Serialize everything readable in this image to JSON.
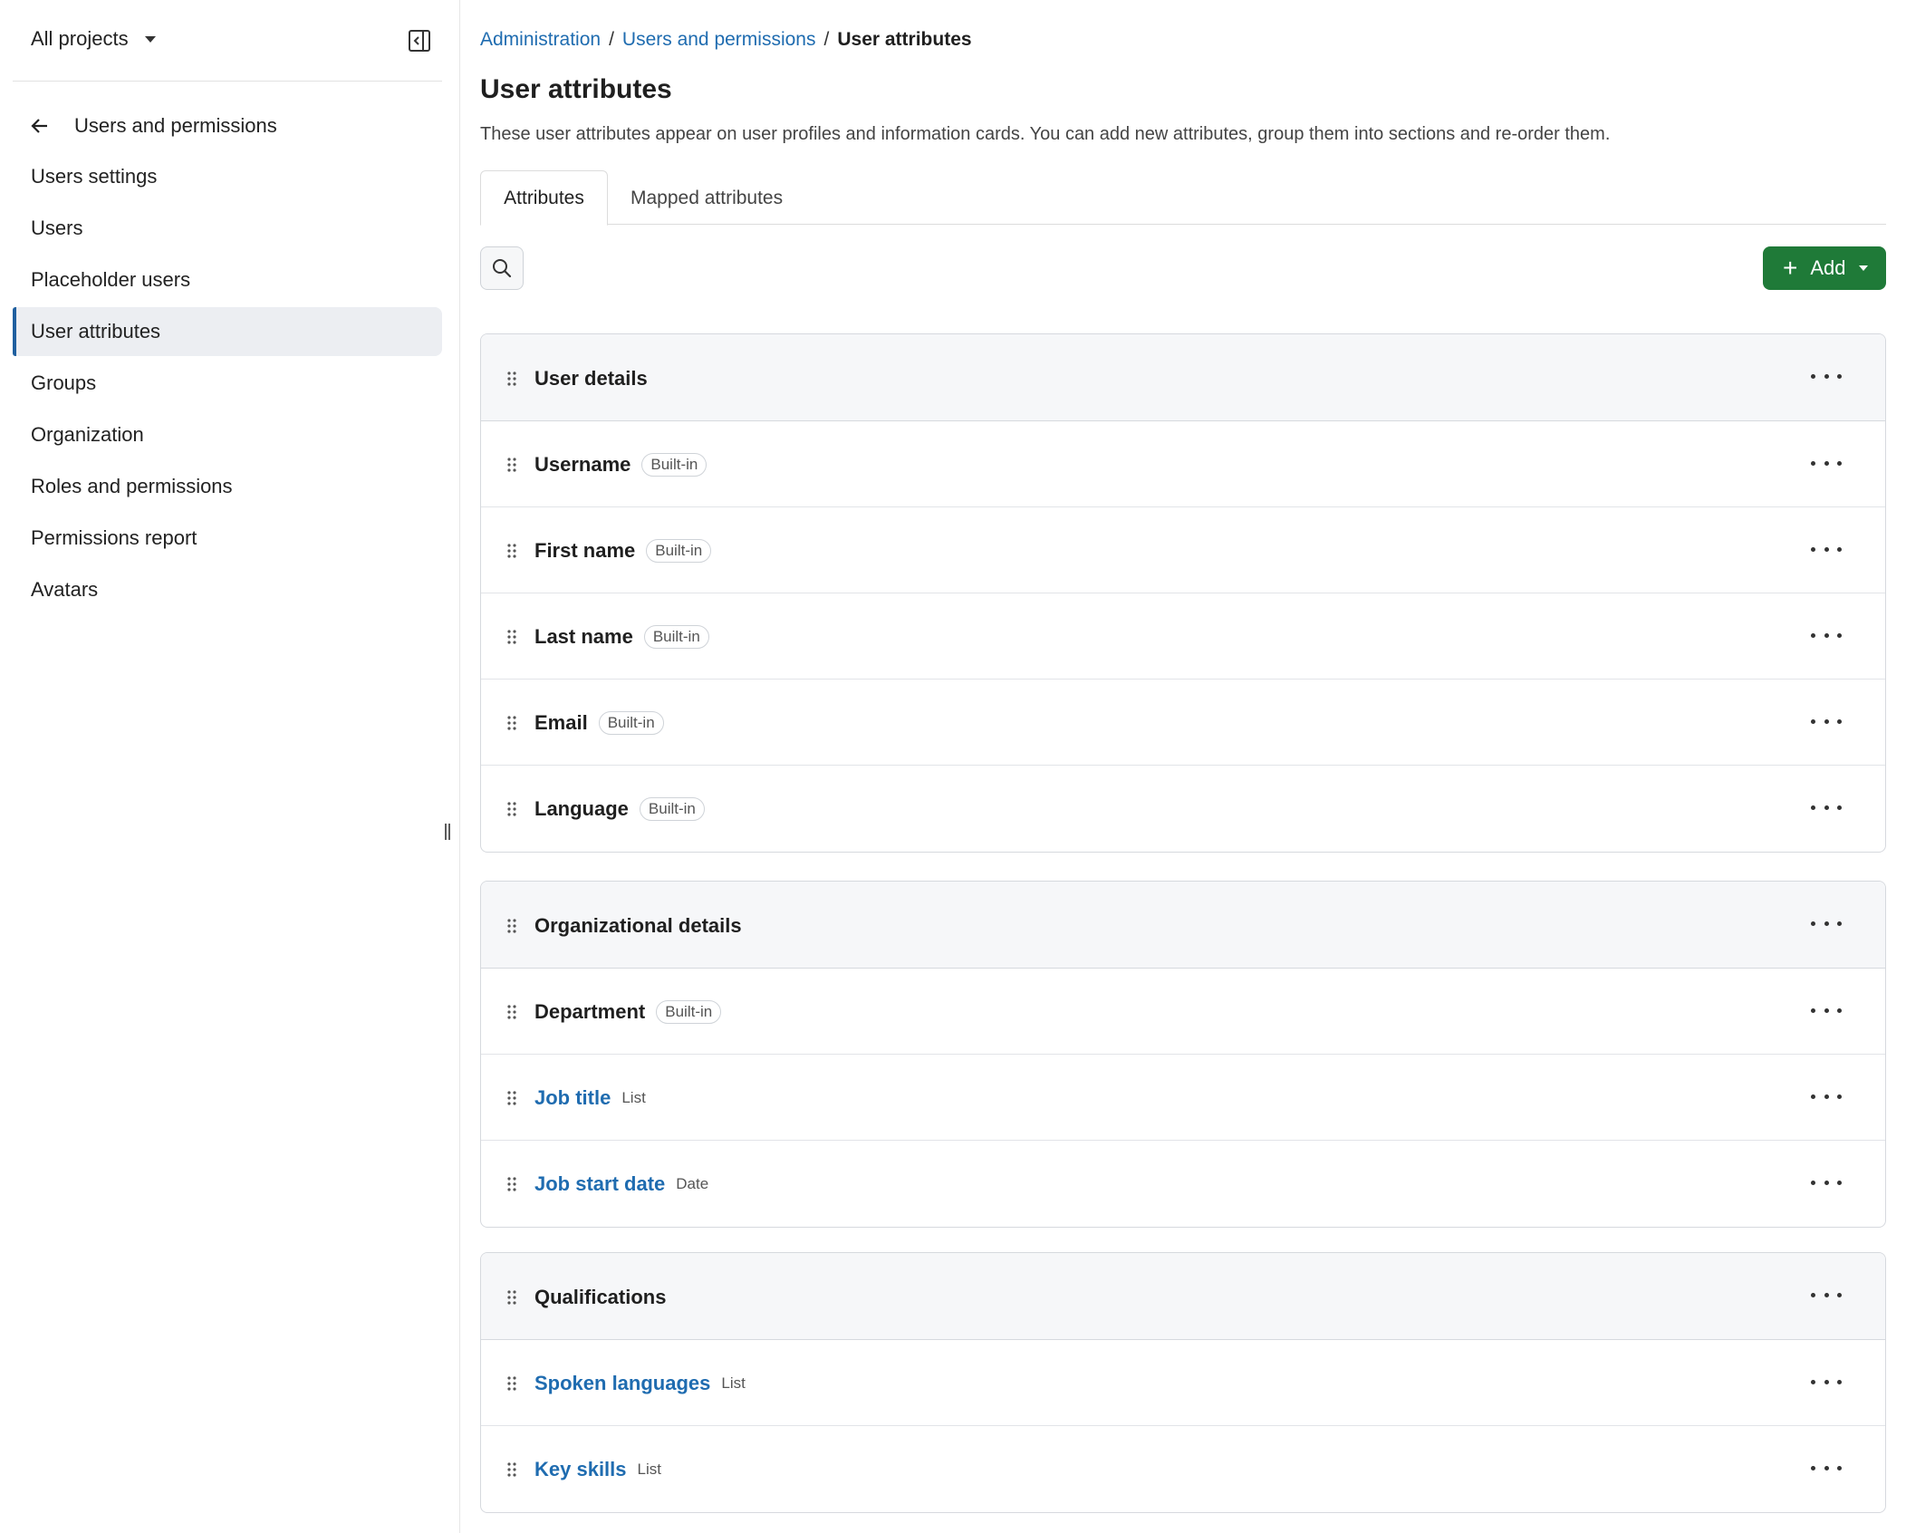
{
  "sidebar": {
    "project_switcher": "All projects",
    "back_label": "Users and permissions",
    "items": [
      {
        "label": "Users settings"
      },
      {
        "label": "Users"
      },
      {
        "label": "Placeholder users"
      },
      {
        "label": "User attributes",
        "active": true
      },
      {
        "label": "Groups"
      },
      {
        "label": "Organization"
      },
      {
        "label": "Roles and permissions"
      },
      {
        "label": "Permissions report"
      },
      {
        "label": "Avatars"
      }
    ]
  },
  "breadcrumb": {
    "items": [
      "Administration",
      "Users and permissions"
    ],
    "current": "User attributes",
    "separator": "/"
  },
  "page": {
    "title": "User attributes",
    "description": "These user attributes appear on user profiles and information cards. You can add new attributes, group them into sections and re-order them."
  },
  "tabs": [
    "Attributes",
    "Mapped attributes"
  ],
  "toolbar": {
    "add_label": "Add",
    "add_icon": "+"
  },
  "sections": [
    {
      "title": "User details",
      "attributes": [
        {
          "name": "Username",
          "tag": "Built-in"
        },
        {
          "name": "First name",
          "tag": "Built-in"
        },
        {
          "name": "Last name",
          "tag": "Built-in"
        },
        {
          "name": "Email",
          "tag": "Built-in"
        },
        {
          "name": "Language",
          "tag": "Built-in"
        }
      ]
    },
    {
      "title": "Organizational details",
      "attributes": [
        {
          "name": "Department",
          "tag": "Built-in"
        },
        {
          "name": "Job title",
          "type": "List"
        },
        {
          "name": "Job start date",
          "type": "Date"
        }
      ]
    },
    {
      "title": "Qualifications",
      "attributes": [
        {
          "name": "Spoken languages",
          "type": "List"
        },
        {
          "name": "Key skills",
          "type": "List"
        }
      ]
    }
  ],
  "colors": {
    "accent": "#1f6cb0",
    "primary_button": "#1f7a38",
    "active_nav_bar": "#1f5f9f"
  }
}
